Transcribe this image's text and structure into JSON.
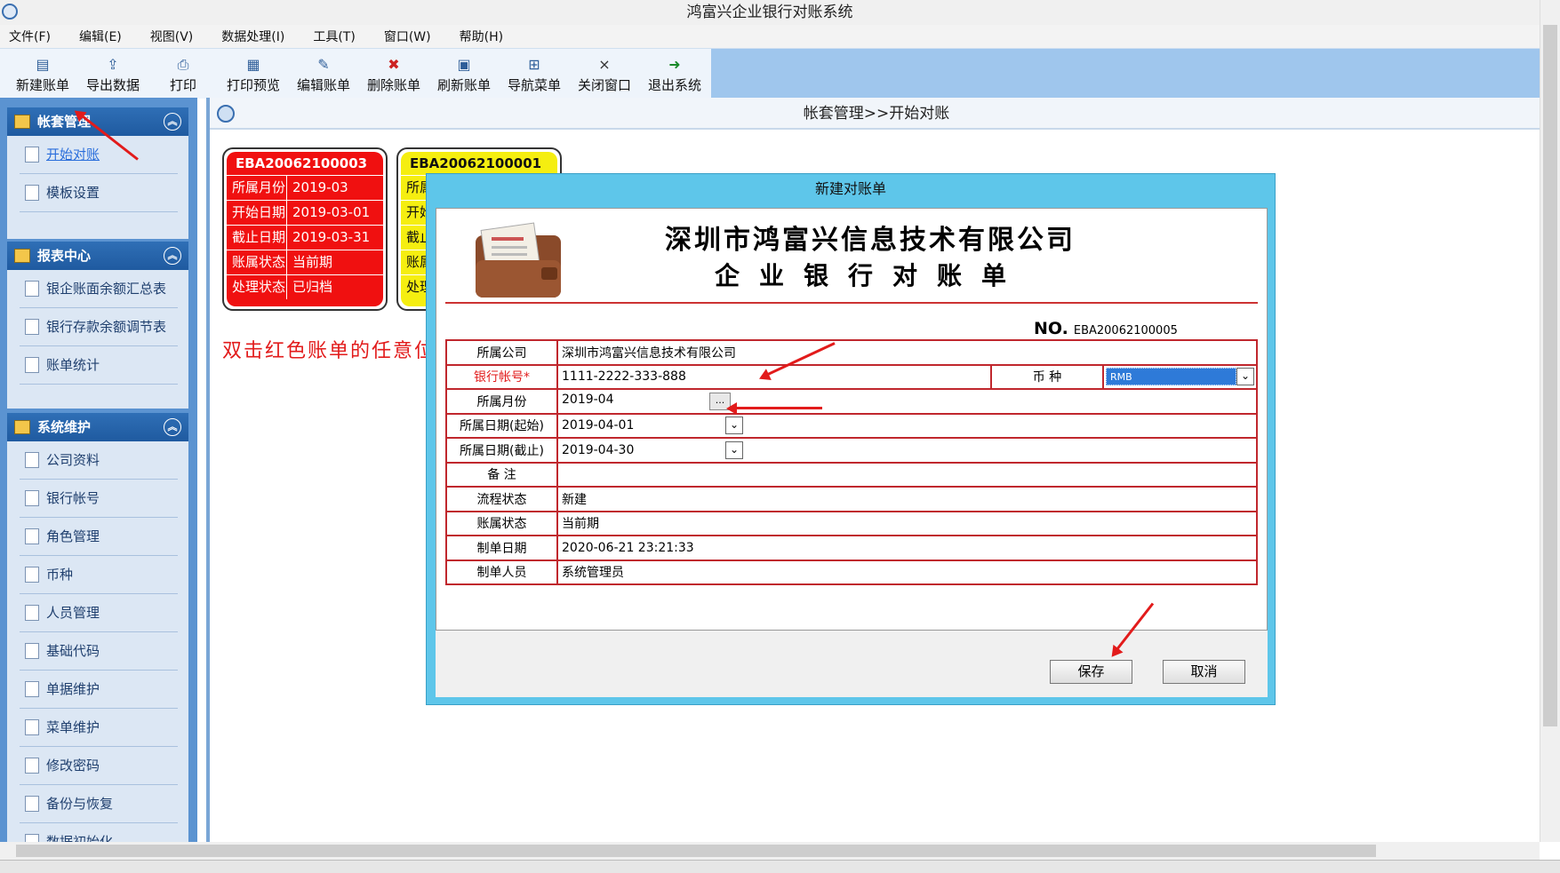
{
  "window": {
    "title": "鸿富兴企业银行对账系统"
  },
  "menu": [
    "文件(F)",
    "编辑(E)",
    "视图(V)",
    "数据处理(I)",
    "工具(T)",
    "窗口(W)",
    "帮助(H)"
  ],
  "toolbar": [
    {
      "label": "新建账单",
      "icon": "new-doc-icon"
    },
    {
      "label": "导出数据",
      "icon": "export-icon"
    },
    {
      "label": "打印",
      "icon": "print-icon"
    },
    {
      "label": "打印预览",
      "icon": "print-preview-icon"
    },
    {
      "label": "编辑账单",
      "icon": "edit-icon"
    },
    {
      "label": "删除账单",
      "icon": "delete-icon"
    },
    {
      "label": "刷新账单",
      "icon": "refresh-icon"
    },
    {
      "label": "导航菜单",
      "icon": "nav-icon"
    },
    {
      "label": "关闭窗口",
      "icon": "close-icon"
    },
    {
      "label": "退出系统",
      "icon": "exit-icon"
    }
  ],
  "sidebar": {
    "groups": [
      {
        "title": "帐套管理",
        "items": [
          "开始对账",
          "模板设置"
        ]
      },
      {
        "title": "报表中心",
        "items": [
          "银企账面余额汇总表",
          "银行存款余额调节表",
          "账单统计"
        ]
      },
      {
        "title": "系统维护",
        "items": [
          "公司资料",
          "银行帐号",
          "角色管理",
          "币种",
          "人员管理",
          "基础代码",
          "单据维护",
          "菜单维护",
          "修改密码",
          "备份与恢复",
          "数据初始化"
        ]
      }
    ]
  },
  "breadcrumb": "帐套管理>>开始对账",
  "cards": [
    {
      "no": "EBA20062100003",
      "color": "#f01010",
      "rows": [
        [
          "所属月份",
          "2019-03"
        ],
        [
          "开始日期",
          "2019-03-01"
        ],
        [
          "截止日期",
          "2019-03-31"
        ],
        [
          "账属状态",
          "当前期"
        ],
        [
          "处理状态",
          "已归档"
        ]
      ]
    },
    {
      "no": "EBA20062100001",
      "color": "#f5ee10",
      "rows": [
        [
          "所属月份",
          ""
        ],
        [
          "开始日期",
          ""
        ],
        [
          "截止日期",
          ""
        ],
        [
          "账属状态",
          ""
        ],
        [
          "处理状态",
          ""
        ]
      ]
    }
  ],
  "hint": "双击红色账单的任意位",
  "dialog": {
    "title": "新建对账单",
    "company": "深圳市鸿富兴信息技术有限公司",
    "doc_title": "企业银行对账单",
    "no_label": "NO.",
    "no_value": "EBA20062100005",
    "fields": {
      "company_label": "所属公司",
      "company": "深圳市鸿富兴信息技术有限公司",
      "account_label": "银行帐号*",
      "account": "1111-2222-333-888",
      "currency_label": "币 种",
      "currency": "RMB",
      "month_label": "所属月份",
      "month": "2019-04",
      "month_btn": "...",
      "start_label": "所属日期(起始)",
      "start": "2019-04-01",
      "end_label": "所属日期(截止)",
      "end": "2019-04-30",
      "note_label": "备 注",
      "note": "",
      "flow_label": "流程状态",
      "flow": "新建",
      "period_label": "账属状态",
      "period": "当前期",
      "date_label": "制单日期",
      "date": "2020-06-21 23:21:33",
      "maker_label": "制单人员",
      "maker": "系统管理员"
    },
    "save": "保存",
    "cancel": "取消"
  },
  "colors": {
    "accent": "#5b93d1",
    "alert": "#e21b1b",
    "dialog_frame": "#5ec6ea"
  }
}
